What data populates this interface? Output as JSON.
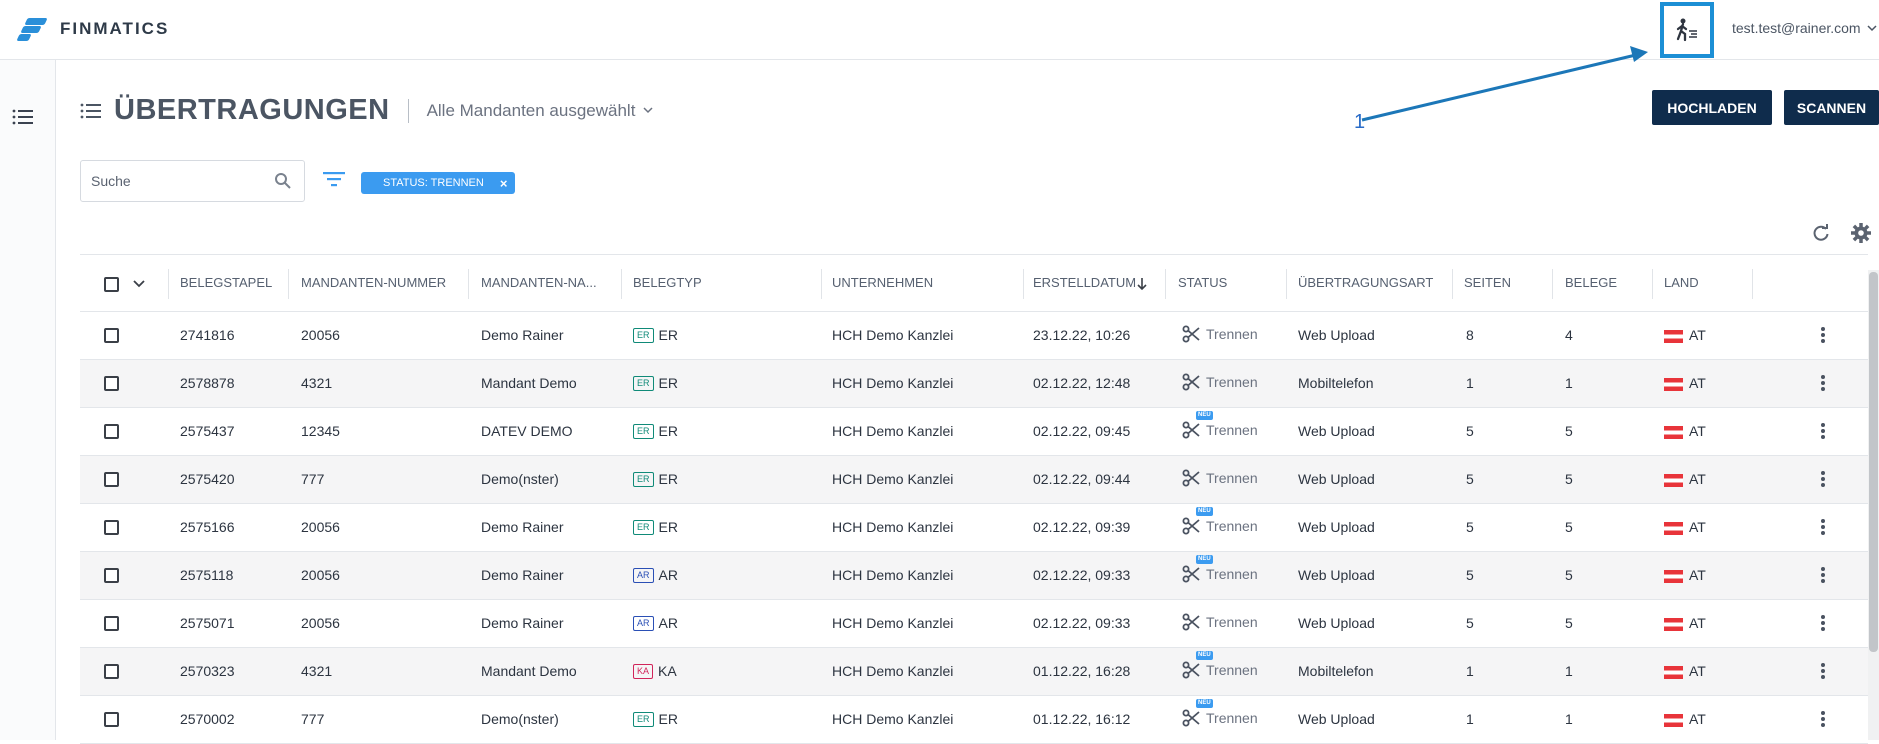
{
  "app": {
    "brand": "FINMATICS"
  },
  "header": {
    "user_email": "test.test@rainer.com"
  },
  "page": {
    "title": "ÜBERTRAGUNGEN",
    "mandant_select": "Alle Mandanten ausgewählt",
    "upload_label": "HOCHLADEN",
    "scan_label": "SCANNEN",
    "annotation_label": "1"
  },
  "search": {
    "placeholder": "Suche"
  },
  "filter": {
    "chip_label": "STATUS: TRENNEN",
    "chip_close": "×"
  },
  "colors": {
    "accent": "#3b9bf0",
    "primary_dark": "#0f2c4c",
    "highlight": "#1c8fd5"
  },
  "table": {
    "columns": [
      "BELEGSTAPEL",
      "MANDANTEN-NUMMER",
      "MANDANTEN-NA...",
      "BELEGTYP",
      "UNTERNEHMEN",
      "ERSTELLDATUM",
      "STATUS",
      "ÜBERTRAGUNGSART",
      "SEITEN",
      "BELEGE",
      "LAND"
    ],
    "rows": [
      {
        "belegstapel": "2741816",
        "nummer": "20056",
        "name": "Demo Rainer",
        "typ": "ER",
        "unternehmen": "HCH Demo Kanzlei",
        "datum": "23.12.22, 10:26",
        "status": "Trennen",
        "new": false,
        "art": "Web Upload",
        "seiten": "8",
        "belege": "4",
        "land": "AT"
      },
      {
        "belegstapel": "2578878",
        "nummer": "4321",
        "name": "Mandant Demo",
        "typ": "ER",
        "unternehmen": "HCH Demo Kanzlei",
        "datum": "02.12.22, 12:48",
        "status": "Trennen",
        "new": false,
        "art": "Mobiltelefon",
        "seiten": "1",
        "belege": "1",
        "land": "AT"
      },
      {
        "belegstapel": "2575437",
        "nummer": "12345",
        "name": "DATEV DEMO",
        "typ": "ER",
        "unternehmen": "HCH Demo Kanzlei",
        "datum": "02.12.22, 09:45",
        "status": "Trennen",
        "new": true,
        "art": "Web Upload",
        "seiten": "5",
        "belege": "5",
        "land": "AT"
      },
      {
        "belegstapel": "2575420",
        "nummer": "777",
        "name": "Demo(nster)",
        "typ": "ER",
        "unternehmen": "HCH Demo Kanzlei",
        "datum": "02.12.22, 09:44",
        "status": "Trennen",
        "new": false,
        "art": "Web Upload",
        "seiten": "5",
        "belege": "5",
        "land": "AT"
      },
      {
        "belegstapel": "2575166",
        "nummer": "20056",
        "name": "Demo Rainer",
        "typ": "ER",
        "unternehmen": "HCH Demo Kanzlei",
        "datum": "02.12.22, 09:39",
        "status": "Trennen",
        "new": true,
        "art": "Web Upload",
        "seiten": "5",
        "belege": "5",
        "land": "AT"
      },
      {
        "belegstapel": "2575118",
        "nummer": "20056",
        "name": "Demo Rainer",
        "typ": "AR",
        "unternehmen": "HCH Demo Kanzlei",
        "datum": "02.12.22, 09:33",
        "status": "Trennen",
        "new": true,
        "art": "Web Upload",
        "seiten": "5",
        "belege": "5",
        "land": "AT"
      },
      {
        "belegstapel": "2575071",
        "nummer": "20056",
        "name": "Demo Rainer",
        "typ": "AR",
        "unternehmen": "HCH Demo Kanzlei",
        "datum": "02.12.22, 09:33",
        "status": "Trennen",
        "new": false,
        "art": "Web Upload",
        "seiten": "5",
        "belege": "5",
        "land": "AT"
      },
      {
        "belegstapel": "2570323",
        "nummer": "4321",
        "name": "Mandant Demo",
        "typ": "KA",
        "unternehmen": "HCH Demo Kanzlei",
        "datum": "01.12.22, 16:28",
        "status": "Trennen",
        "new": true,
        "art": "Mobiltelefon",
        "seiten": "1",
        "belege": "1",
        "land": "AT"
      },
      {
        "belegstapel": "2570002",
        "nummer": "777",
        "name": "Demo(nster)",
        "typ": "ER",
        "unternehmen": "HCH Demo Kanzlei",
        "datum": "01.12.22, 16:12",
        "status": "Trennen",
        "new": true,
        "art": "Web Upload",
        "seiten": "1",
        "belege": "1",
        "land": "AT"
      }
    ],
    "new_badge": "NEU"
  }
}
